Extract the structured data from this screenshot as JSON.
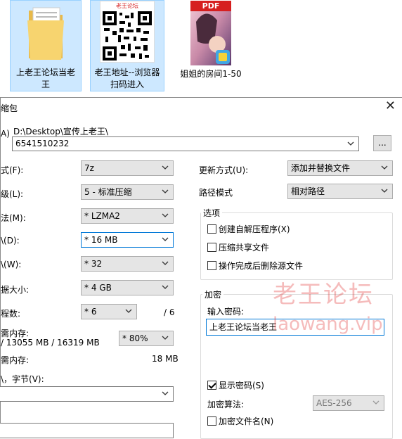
{
  "desktop": {
    "files": [
      {
        "name": "上老王论坛当老王",
        "icon": "folder-icon"
      },
      {
        "name": "老王地址--浏览器扫码进入",
        "icon": "qr-code-icon",
        "thumb_caption": "老王论坛"
      },
      {
        "name": "姐姐的房间1-50",
        "icon": "pdf-icon",
        "thumb_caption": "PDF"
      }
    ]
  },
  "dialog": {
    "title": "缩包",
    "archive_label": "A)",
    "path_text": "D:\\Desktop\\宣传上老王\\",
    "archive_name": "6541510232",
    "browse_label": "...",
    "close_label": "✕",
    "left": {
      "format_label": "式(F):",
      "format_value": "7z",
      "level_label": "级(L):",
      "level_value": "5 - 标准压缩",
      "method_label": "法(M):",
      "method_value": "* LZMA2",
      "dict_label": "\\(D):",
      "dict_value": "* 16 MB",
      "word_label": "\\(W):",
      "word_value": "* 32",
      "solid_label": "据大小:",
      "solid_value": "* 4 GB",
      "threads_label": "程数:",
      "threads_value": "* 6",
      "threads_max": "/ 6",
      "mem_label": "需内存:",
      "mem_value": "/ 13055 MB / 16319 MB",
      "mem_percent": "* 80%",
      "decomp_mem_label": "需内存:",
      "decomp_mem_value": "18 MB",
      "split_label": "\\，字节(V):"
    },
    "right": {
      "update_label": "更新方式(U):",
      "update_value": "添加并替换文件",
      "path_mode_label": "路径模式",
      "path_mode_value": "相对路径",
      "options_title": "选项",
      "options": [
        {
          "label": "创建自解压程序(X)",
          "checked": false
        },
        {
          "label": "压缩共享文件",
          "checked": false
        },
        {
          "label": "操作完成后删除源文件",
          "checked": false
        }
      ],
      "encryption_title": "加密",
      "password_label": "输入密码:",
      "password_value": "上老王论坛当老王",
      "show_password_label": "显示密码(S)",
      "show_password_checked": true,
      "algo_label": "加密算法:",
      "algo_value": "AES-256",
      "encrypt_names_label": "加密文件名(N)",
      "encrypt_names_checked": false
    }
  },
  "watermark": {
    "cn": "老王论坛",
    "en": "laowang.vip"
  },
  "colors": {
    "selection_bg": "#cde8ff",
    "selection_border": "#99d1ff",
    "focus_border": "#0078d7",
    "watermark": "#e13c3c"
  }
}
